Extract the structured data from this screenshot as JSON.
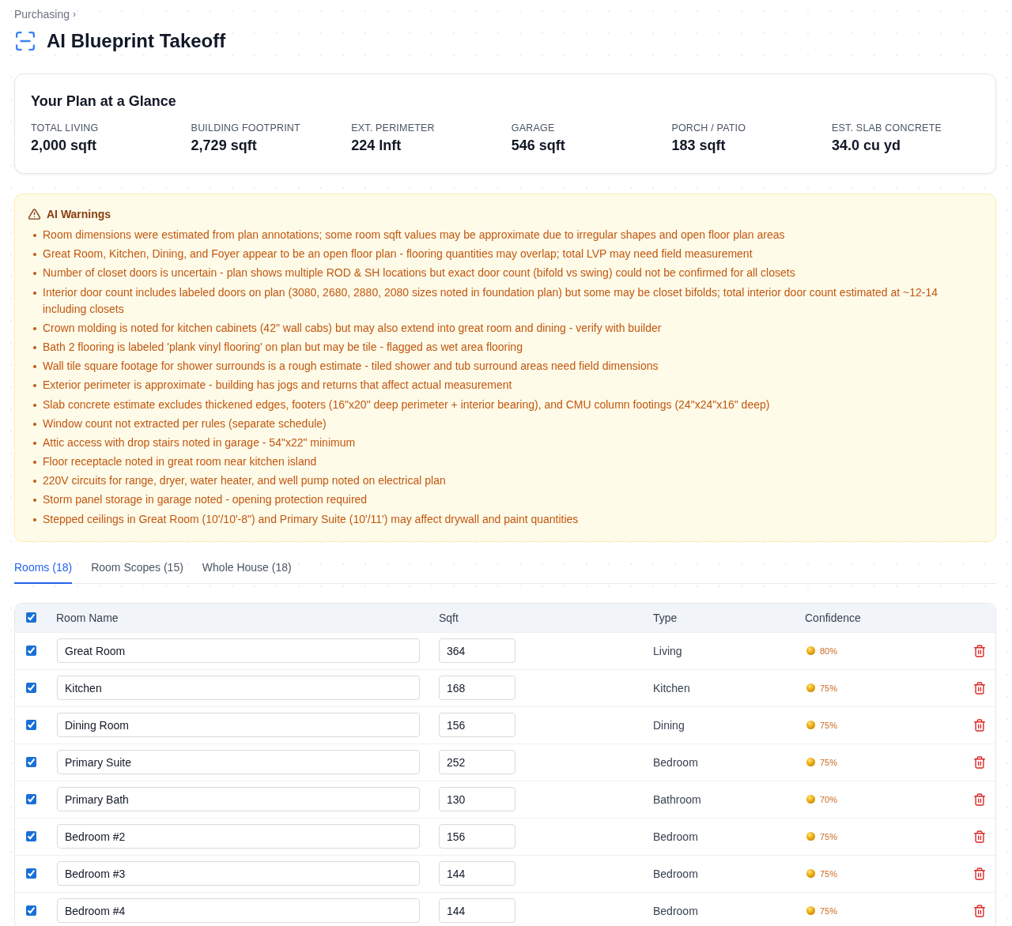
{
  "breadcrumb": {
    "label": "Purchasing",
    "separator": "›"
  },
  "page": {
    "title": "AI Blueprint Takeoff"
  },
  "glance": {
    "title": "Your Plan at a Glance",
    "stats": [
      {
        "label": "TOTAL LIVING",
        "value": "2,000 sqft"
      },
      {
        "label": "BUILDING FOOTPRINT",
        "value": "2,729 sqft"
      },
      {
        "label": "EXT. PERIMETER",
        "value": "224 lnft"
      },
      {
        "label": "GARAGE",
        "value": "546 sqft"
      },
      {
        "label": "PORCH / PATIO",
        "value": "183 sqft"
      },
      {
        "label": "EST. SLAB CONCRETE",
        "value": "34.0 cu yd"
      }
    ]
  },
  "warnings": {
    "title": "AI Warnings",
    "items": [
      "Room dimensions were estimated from plan annotations; some room sqft values may be approximate due to irregular shapes and open floor plan areas",
      "Great Room, Kitchen, Dining, and Foyer appear to be an open floor plan - flooring quantities may overlap; total LVP may need field measurement",
      "Number of closet doors is uncertain - plan shows multiple ROD & SH locations but exact door count (bifold vs swing) could not be confirmed for all closets",
      "Interior door count includes labeled doors on plan (3080, 2680, 2880, 2080 sizes noted in foundation plan) but some may be closet bifolds; total interior door count estimated at ~12-14 including closets",
      "Crown molding is noted for kitchen cabinets (42\" wall cabs) but may also extend into great room and dining - verify with builder",
      "Bath 2 flooring is labeled 'plank vinyl flooring' on plan but may be tile - flagged as wet area flooring",
      "Wall tile square footage for shower surrounds is a rough estimate - tiled shower and tub surround areas need field dimensions",
      "Exterior perimeter is approximate - building has jogs and returns that affect actual measurement",
      "Slab concrete estimate excludes thickened edges, footers (16\"x20\" deep perimeter + interior bearing), and CMU column footings (24\"x24\"x16\" deep)",
      "Window count not extracted per rules (separate schedule)",
      "Attic access with drop stairs noted in garage - 54\"x22\" minimum",
      "Floor receptacle noted in great room near kitchen island",
      "220V circuits for range, dryer, water heater, and well pump noted on electrical plan",
      "Storm panel storage in garage noted - opening protection required",
      "Stepped ceilings in Great Room (10'/10'-8\") and Primary Suite (10'/11') may affect drywall and paint quantities"
    ]
  },
  "tabs": [
    {
      "label": "Rooms (18)",
      "selected": true
    },
    {
      "label": "Room Scopes (15)",
      "selected": false
    },
    {
      "label": "Whole House (18)",
      "selected": false
    }
  ],
  "table": {
    "select_all_checked": true,
    "columns": [
      "Room Name",
      "Sqft",
      "Type",
      "Confidence"
    ],
    "rows": [
      {
        "checked": true,
        "name": "Great Room",
        "sqft": "364",
        "type": "Living",
        "confidence": "80%"
      },
      {
        "checked": true,
        "name": "Kitchen",
        "sqft": "168",
        "type": "Kitchen",
        "confidence": "75%"
      },
      {
        "checked": true,
        "name": "Dining Room",
        "sqft": "156",
        "type": "Dining",
        "confidence": "75%"
      },
      {
        "checked": true,
        "name": "Primary Suite",
        "sqft": "252",
        "type": "Bedroom",
        "confidence": "75%"
      },
      {
        "checked": true,
        "name": "Primary Bath",
        "sqft": "130",
        "type": "Bathroom",
        "confidence": "70%"
      },
      {
        "checked": true,
        "name": "Bedroom #2",
        "sqft": "156",
        "type": "Bedroom",
        "confidence": "75%"
      },
      {
        "checked": true,
        "name": "Bedroom #3",
        "sqft": "144",
        "type": "Bedroom",
        "confidence": "75%"
      },
      {
        "checked": true,
        "name": "Bedroom #4",
        "sqft": "144",
        "type": "Bedroom",
        "confidence": "75%"
      }
    ]
  }
}
